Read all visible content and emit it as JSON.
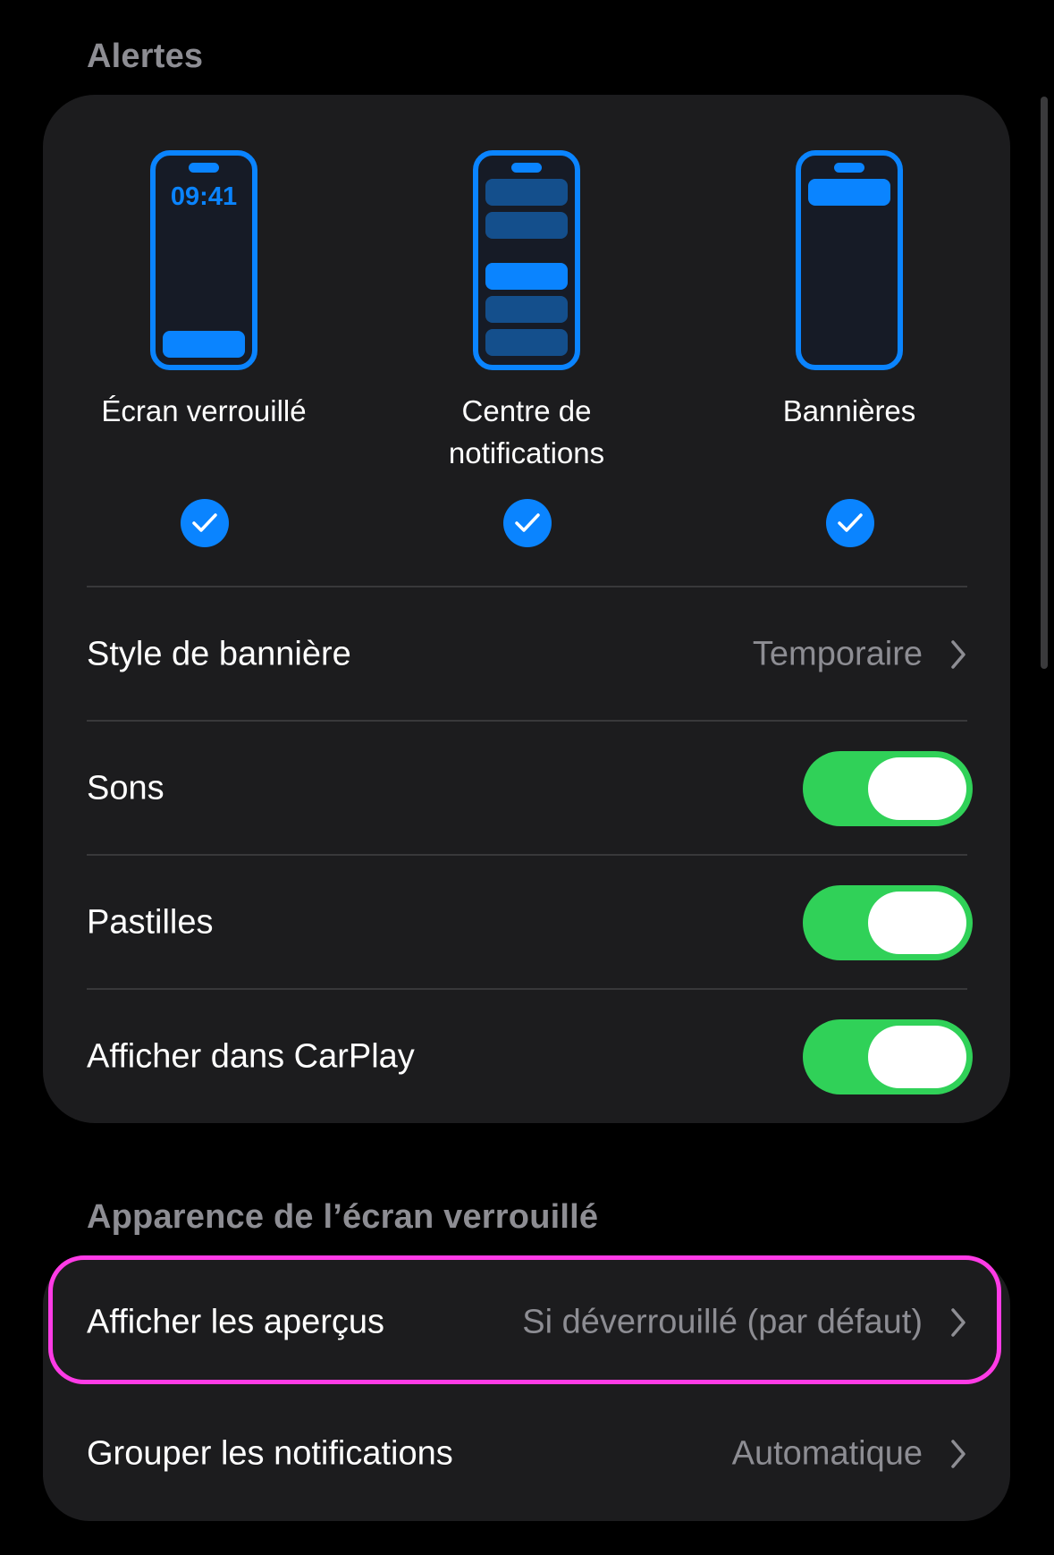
{
  "alerts": {
    "title": "Alertes",
    "options": [
      {
        "label": "Écran verrouillé",
        "checked": true,
        "phone_time": "09:41"
      },
      {
        "label": "Centre de\nnotifications",
        "checked": true
      },
      {
        "label": "Bannières",
        "checked": true
      }
    ],
    "rows": [
      {
        "label": "Style de bannière",
        "value": "Temporaire"
      },
      {
        "label": "Sons",
        "toggle": true
      },
      {
        "label": "Pastilles",
        "toggle": true
      },
      {
        "label": "Afficher dans CarPlay",
        "toggle": true
      }
    ]
  },
  "lock_screen": {
    "title": "Apparence de l’écran verrouillé",
    "rows": [
      {
        "label": "Afficher les aperçus",
        "value": "Si déverrouillé (par défaut)"
      },
      {
        "label": "Grouper les notifications",
        "value": "Automatique"
      }
    ]
  },
  "colors": {
    "accent": "#0a84ff",
    "toggle_on": "#30d158",
    "highlight": "#ff3be6",
    "card": "#1c1c1e"
  },
  "icons": [
    "checkmark-icon",
    "chevron-right-icon",
    "phone-lock-screen-icon",
    "phone-notification-center-icon",
    "phone-banner-icon"
  ]
}
